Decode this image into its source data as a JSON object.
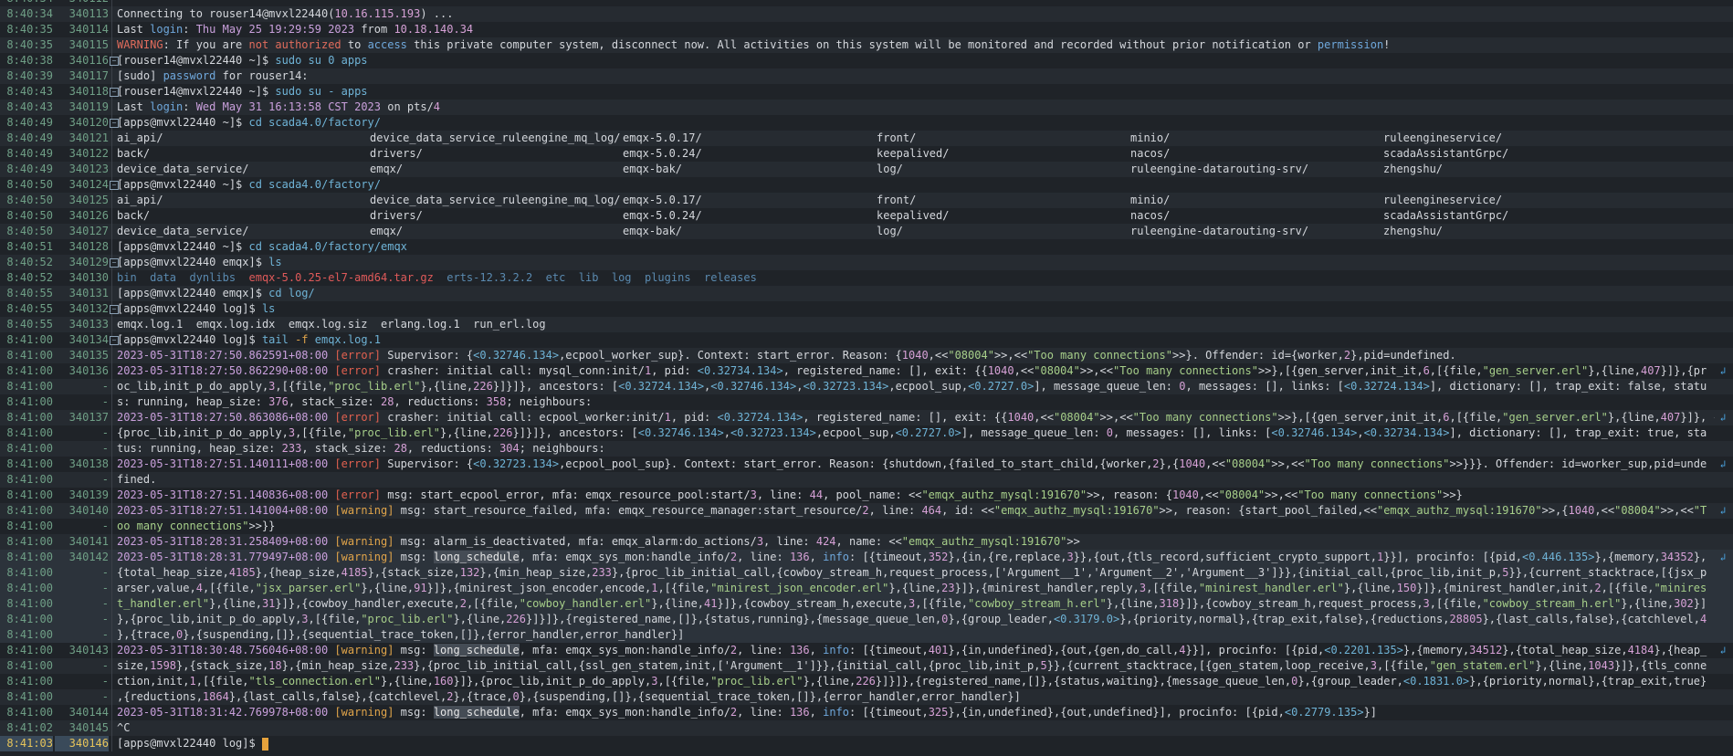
{
  "terminal": {
    "lines": [
      {
        "ts": "8:40:34",
        "ln": "340112",
        "html": ""
      },
      {
        "ts": "8:40:34",
        "ln": "340113",
        "html": "Connecting to rouser14@mvxl22440(<span class='c-ip'>10.16.115.193</span>) ..."
      },
      {
        "ts": "8:40:35",
        "ln": "340114",
        "html": "Last <span class='c-blue'>login</span>: <span class='c-date'>Thu May 25 19:29:59 2023</span> from <span class='c-ip'>10.18.140.34</span>"
      },
      {
        "ts": "8:40:35",
        "ln": "340115",
        "html": "<span class='c-warnword'>WARNING</span>: If you are <span class='c-warnword'>not authorized</span> to <span class='c-blue'>access</span> this private computer system, disconnect now. All activities on this system will be monitored and recorded without prior notification or <span class='c-blue'>permission</span>!"
      },
      {
        "ts": "8:40:38",
        "ln": "340116",
        "fold": true,
        "html": "[rouser14@mvxl22440 ~]$ <span class='c-cmd'>sudo su 0 apps</span>"
      },
      {
        "ts": "8:40:39",
        "ln": "340117",
        "html": "[sudo] <span class='c-blue'>password</span> for rouser14:"
      },
      {
        "ts": "8:40:43",
        "ln": "340118",
        "fold": true,
        "html": "[rouser14@mvxl22440 ~]$ <span class='c-cmd'>sudo su - apps</span>"
      },
      {
        "ts": "8:40:43",
        "ln": "340119",
        "html": "Last <span class='c-blue'>login</span>: <span class='c-date'>Wed May 31 16:13:58 CST 2023</span> on pts/<span class='c-num'>4</span>"
      },
      {
        "ts": "8:40:49",
        "ln": "340120",
        "fold": true,
        "html": "[apps@mvxl22440 ~]$ <span class='c-cmd'>cd scada4.0/factory/</span>"
      },
      {
        "ts": "8:40:49",
        "ln": "340121",
        "cols": [
          "ai_api/",
          "device_data_service_ruleengine_mq_log/",
          "emqx-5.0.17/",
          "front/",
          "minio/",
          "ruleengineservice/"
        ]
      },
      {
        "ts": "8:40:49",
        "ln": "340122",
        "cols": [
          "back/",
          "drivers/",
          "emqx-5.0.24/",
          "keepalived/",
          "nacos/",
          "scadaAssistantGrpc/"
        ]
      },
      {
        "ts": "8:40:49",
        "ln": "340123",
        "cols": [
          "device_data_service/",
          "emqx/",
          "emqx-bak/",
          "log/",
          "ruleengine-datarouting-srv/",
          "zhengshu/"
        ]
      },
      {
        "ts": "8:40:50",
        "ln": "340124",
        "fold": true,
        "html": "[apps@mvxl22440 ~]$ <span class='c-cmd'>cd scada4.0/factory/</span>"
      },
      {
        "ts": "8:40:50",
        "ln": "340125",
        "cols": [
          "ai_api/",
          "device_data_service_ruleengine_mq_log/",
          "emqx-5.0.17/",
          "front/",
          "minio/",
          "ruleengineservice/"
        ]
      },
      {
        "ts": "8:40:50",
        "ln": "340126",
        "cols": [
          "back/",
          "drivers/",
          "emqx-5.0.24/",
          "keepalived/",
          "nacos/",
          "scadaAssistantGrpc/"
        ]
      },
      {
        "ts": "8:40:50",
        "ln": "340127",
        "cols": [
          "device_data_service/",
          "emqx/",
          "emqx-bak/",
          "log/",
          "ruleengine-datarouting-srv/",
          "zhengshu/"
        ]
      },
      {
        "ts": "8:40:51",
        "ln": "340128",
        "html": "[apps@mvxl22440 ~]$ <span class='c-cmd'>cd scada4.0/factory/emqx</span>"
      },
      {
        "ts": "8:40:52",
        "ln": "340129",
        "fold": true,
        "html": "[apps@mvxl22440 emqx]$ <span class='c-cmd'>ls</span>"
      },
      {
        "ts": "8:40:52",
        "ln": "340130",
        "html": "<span class='c-ls'>bin  data  dynlibs  </span><span class='c-tar'>emqx-5.0.25-el7-amd64.tar.gz</span><span class='c-ls'>  erts-12.3.2.2  etc  lib  log  plugins  releases</span>"
      },
      {
        "ts": "8:40:55",
        "ln": "340131",
        "html": "[apps@mvxl22440 emqx]$ <span class='c-cmd'>cd log/</span>"
      },
      {
        "ts": "8:40:55",
        "ln": "340132",
        "fold": true,
        "html": "[apps@mvxl22440 log]$ <span class='c-cmd'>ls</span>"
      },
      {
        "ts": "8:40:55",
        "ln": "340133",
        "html": "emqx.log.1  emqx.log.idx  emqx.log.siz  erlang.log.1  run_erl.log"
      },
      {
        "ts": "8:41:00",
        "ln": "340134",
        "fold": true,
        "html": "[apps@mvxl22440 log]$ <span class='c-cmd'>tail <span class='c-warn'>-f</span> emqx.log.1</span>"
      },
      {
        "ts": "8:41:00",
        "ln": "340135",
        "html": "<span class='c-date'>2023-05-31T18:27:50.862591+08:00</span> <span class='c-lvl'>[error]</span> Supervisor: {<span class='c-pid'>&lt;0.32746.134&gt;</span>,ecpool_worker_sup}. Context: start_error. Reason: {<span class='c-num'>1040</span>,&lt;&lt;<span class='c-str'>\"08004\"</span>&gt;&gt;,&lt;&lt;<span class='c-str'>\"Too many connections\"</span>&gt;&gt;}. Offender: id={worker,<span class='c-num'>2</span>},pid=undefined."
      },
      {
        "ts": "8:41:00",
        "ln": "340136",
        "wrap": true,
        "html": "<span class='c-date'>2023-05-31T18:27:50.862290+08:00</span> <span class='c-lvl'>[error]</span> crasher: initial call: mysql_conn:init/<span class='c-num'>1</span>, pid: <span class='c-pid'>&lt;0.32734.134&gt;</span>, registered_name: [], exit: {{<span class='c-num'>1040</span>,&lt;&lt;<span class='c-str'>\"08004\"</span>&gt;&gt;,&lt;&lt;<span class='c-str'>\"Too many connections\"</span>&gt;&gt;},[{gen_server,init_it,<span class='c-num'>6</span>,[{file,<span class='c-str'>\"gen_server.erl\"</span>},{line,<span class='c-num'>407</span>}]},{pr"
      },
      {
        "ts": "8:41:00",
        "ln": "-",
        "html": "oc_lib,init_p_do_apply,<span class='c-num'>3</span>,[{file,<span class='c-str'>\"proc_lib.erl\"</span>},{line,<span class='c-num'>226</span>}]}]}, ancestors: [<span class='c-pid'>&lt;0.32724.134&gt;</span>,<span class='c-pid'>&lt;0.32746.134&gt;</span>,<span class='c-pid'>&lt;0.32723.134&gt;</span>,ecpool_sup,<span class='c-pid'>&lt;0.2727.0&gt;</span>], message_queue_len: <span class='c-num'>0</span>, messages: [], links: [<span class='c-pid'>&lt;0.32724.134&gt;</span>], dictionary: [], trap_exit: false, statu"
      },
      {
        "ts": "8:41:00",
        "ln": "-",
        "html": "s: running, heap_size: <span class='c-num'>376</span>, stack_size: <span class='c-num'>28</span>, reductions: <span class='c-num'>358</span>; neighbours:"
      },
      {
        "ts": "8:41:00",
        "ln": "340137",
        "wrap": true,
        "html": "<span class='c-date'>2023-05-31T18:27:50.863086+08:00</span> <span class='c-lvl'>[error]</span> crasher: initial call: ecpool_worker:init/<span class='c-num'>1</span>, pid: <span class='c-pid'>&lt;0.32724.134&gt;</span>, registered_name: [], exit: {{<span class='c-num'>1040</span>,&lt;&lt;<span class='c-str'>\"08004\"</span>&gt;&gt;,&lt;&lt;<span class='c-str'>\"Too many connections\"</span>&gt;&gt;},[{gen_server,init_it,<span class='c-num'>6</span>,[{file,<span class='c-str'>\"gen_server.erl\"</span>},{line,<span class='c-num'>407</span>}]}, {"
      },
      {
        "ts": "8:41:00",
        "ln": "-",
        "html": "{proc_lib,init_p_do_apply,<span class='c-num'>3</span>,[{file,<span class='c-str'>\"proc_lib.erl\"</span>},{line,<span class='c-num'>226</span>}]}]}, ancestors: [<span class='c-pid'>&lt;0.32746.134&gt;</span>,<span class='c-pid'>&lt;0.32723.134&gt;</span>,ecpool_sup,<span class='c-pid'>&lt;0.2727.0&gt;</span>], message_queue_len: <span class='c-num'>0</span>, messages: [], links: [<span class='c-pid'>&lt;0.32746.134&gt;</span>,<span class='c-pid'>&lt;0.32734.134&gt;</span>], dictionary: [], trap_exit: true, sta"
      },
      {
        "ts": "8:41:00",
        "ln": "-",
        "html": "tus: running, heap_size: <span class='c-num'>233</span>, stack_size: <span class='c-num'>28</span>, reductions: <span class='c-num'>304</span>; neighbours:"
      },
      {
        "ts": "8:41:00",
        "ln": "340138",
        "wrap": true,
        "html": "<span class='c-date'>2023-05-31T18:27:51.140111+08:00</span> <span class='c-lvl'>[error]</span> Supervisor: {<span class='c-pid'>&lt;0.32723.134&gt;</span>,ecpool_pool_sup}. Context: start_error. Reason: {shutdown,{failed_to_start_child,{worker,<span class='c-num'>2</span>},{<span class='c-num'>1040</span>,&lt;&lt;<span class='c-str'>\"08004\"</span>&gt;&gt;,&lt;&lt;<span class='c-str'>\"Too many connections\"</span>&gt;&gt;}}}. Offender: id=worker_sup,pid=unde"
      },
      {
        "ts": "8:41:00",
        "ln": "-",
        "html": "fined."
      },
      {
        "ts": "8:41:00",
        "ln": "340139",
        "html": "<span class='c-date'>2023-05-31T18:27:51.140836+08:00</span> <span class='c-lvl'>[error]</span> msg: start_ecpool_error, mfa: emqx_resource_pool:start/<span class='c-num'>3</span>, line: <span class='c-num'>44</span>, pool_name: &lt;&lt;<span class='c-str'>\"emqx_authz_mysql:191670\"</span>&gt;&gt;, reason: {<span class='c-num'>1040</span>,&lt;&lt;<span class='c-str'>\"08004\"</span>&gt;&gt;,&lt;&lt;<span class='c-str'>\"Too many connections\"</span>&gt;&gt;}"
      },
      {
        "ts": "8:41:00",
        "ln": "340140",
        "wrap": true,
        "html": "<span class='c-date'>2023-05-31T18:27:51.141004+08:00</span> <span class='c-warn'>[warning]</span> msg: start_resource_failed, mfa: emqx_resource_manager:start_resource/<span class='c-num'>2</span>, line: <span class='c-num'>464</span>, id: &lt;&lt;<span class='c-str'>\"emqx_authz_mysql:191670\"</span>&gt;&gt;, reason: {start_pool_failed,&lt;&lt;<span class='c-str'>\"emqx_authz_mysql:191670\"</span>&gt;&gt;,{<span class='c-num'>1040</span>,&lt;&lt;<span class='c-str'>\"08004\"</span>&gt;&gt;,&lt;&lt;<span class='c-str'>\"T</span>"
      },
      {
        "ts": "8:41:00",
        "ln": "-",
        "html": "<span class='c-str'>oo many connections\"</span>&gt;&gt;}}"
      },
      {
        "ts": "8:41:00",
        "ln": "340141",
        "html": "<span class='c-date'>2023-05-31T18:28:31.258409+08:00</span> <span class='c-warn'>[warning]</span> msg: alarm_is_deactivated, mfa: emqx_alarm:do_actions/<span class='c-num'>3</span>, line: <span class='c-num'>424</span>, name: &lt;&lt;<span class='c-str'>\"emqx_authz_mysql:191670\"</span>&gt;&gt;"
      },
      {
        "ts": "8:41:00",
        "ln": "340142",
        "wrap": true,
        "hl": true,
        "html": "<span class='c-date'>2023-05-31T18:28:31.779497+08:00</span> <span class='c-warn'>[warning]</span> msg: <span class='c-long'>long_schedule</span>, mfa: emqx_sys_mon:handle_info/<span class='c-num'>2</span>, line: <span class='c-num'>136</span>, <span class='c-blue'>info</span>: [{timeout,<span class='c-num'>352</span>},{in,{re,replace,<span class='c-num'>3</span>}},{out,{tls_record,sufficient_crypto_support,<span class='c-num'>1</span>}}], procinfo: [{pid,<span class='c-pid'>&lt;0.446.135&gt;</span>},{memory,<span class='c-num'>34352</span>},"
      },
      {
        "ts": "8:41:00",
        "ln": "-",
        "hl": true,
        "html": "{total_heap_size,<span class='c-num'>4185</span>},{heap_size,<span class='c-num'>4185</span>},{stack_size,<span class='c-num'>132</span>},{min_heap_size,<span class='c-num'>233</span>},{proc_lib_initial_call,{cowboy_stream_h,request_process,['Argument__1','Argument__2','Argument__3']}},{initial_call,{proc_lib,init_p,<span class='c-num'>5</span>}},{current_stacktrace,[{jsx_p"
      },
      {
        "ts": "8:41:00",
        "ln": "-",
        "hl": true,
        "html": "arser,value,<span class='c-num'>4</span>,[{file,<span class='c-str'>\"jsx_parser.erl\"</span>},{line,<span class='c-num'>91</span>}]},{minirest_json_encoder,encode,<span class='c-num'>1</span>,[{file,<span class='c-str'>\"minirest_json_encoder.erl\"</span>},{line,<span class='c-num'>23</span>}]},{minirest_handler,reply,<span class='c-num'>3</span>,[{file,<span class='c-str'>\"minirest_handler.erl\"</span>},{line,<span class='c-num'>150</span>}]},{minirest_handler,init,<span class='c-num'>2</span>,[{file,<span class='c-str'>\"minires</span>"
      },
      {
        "ts": "8:41:00",
        "ln": "-",
        "hl": true,
        "html": "<span class='c-str'>t_handler.erl\"</span>},{line,<span class='c-num'>31</span>}]},{cowboy_handler,execute,<span class='c-num'>2</span>,[{file,<span class='c-str'>\"cowboy_handler.erl\"</span>},{line,<span class='c-num'>41</span>}]},{cowboy_stream_h,execute,<span class='c-num'>3</span>,[{file,<span class='c-str'>\"cowboy_stream_h.erl\"</span>},{line,<span class='c-num'>318</span>}]},{cowboy_stream_h,request_process,<span class='c-num'>3</span>,[{file,<span class='c-str'>\"cowboy_stream_h.erl\"</span>},{line,<span class='c-num'>302</span>}]"
      },
      {
        "ts": "8:41:00",
        "ln": "-",
        "hl": true,
        "html": "},{proc_lib,init_p_do_apply,<span class='c-num'>3</span>,[{file,<span class='c-str'>\"proc_lib.erl\"</span>},{line,<span class='c-num'>226</span>}]}]},{registered_name,[]},{status,running},{message_queue_len,<span class='c-num'>0</span>},{group_leader,<span class='c-pid'>&lt;0.3179.0&gt;</span>},{priority,normal},{trap_exit,false},{reductions,<span class='c-num'>28805</span>},{last_calls,false},{catchlevel,<span class='c-num'>4</span>"
      },
      {
        "ts": "8:41:00",
        "ln": "-",
        "hl": true,
        "html": "},{trace,<span class='c-num'>0</span>},{suspending,[]},{sequential_trace_token,[]},{error_handler,error_handler}]"
      },
      {
        "ts": "8:41:00",
        "ln": "340143",
        "wrap": true,
        "html": "<span class='c-date'>2023-05-31T18:30:48.756046+08:00</span> <span class='c-warn'>[warning]</span> msg: <span class='c-long'>long_schedule</span>, mfa: emqx_sys_mon:handle_info/<span class='c-num'>2</span>, line: <span class='c-num'>136</span>, <span class='c-blue'>info</span>: [{timeout,<span class='c-num'>401</span>},{in,undefined},{out,{gen,do_call,<span class='c-num'>4</span>}}], procinfo: [{pid,<span class='c-pid'>&lt;0.2201.135&gt;</span>},{memory,<span class='c-num'>34512</span>},{total_heap_size,<span class='c-num'>4184</span>},{heap_"
      },
      {
        "ts": "8:41:00",
        "ln": "-",
        "html": "size,<span class='c-num'>1598</span>},{stack_size,<span class='c-num'>18</span>},{min_heap_size,<span class='c-num'>233</span>},{proc_lib_initial_call,{ssl_gen_statem,init,['Argument__1']}},{initial_call,{proc_lib,init_p,<span class='c-num'>5</span>}},{current_stacktrace,[{gen_statem,loop_receive,<span class='c-num'>3</span>,[{file,<span class='c-str'>\"gen_statem.erl\"</span>},{line,<span class='c-num'>1043</span>}]},{tls_conne"
      },
      {
        "ts": "8:41:00",
        "ln": "-",
        "html": "ction,init,<span class='c-num'>1</span>,[{file,<span class='c-str'>\"tls_connection.erl\"</span>},{line,<span class='c-num'>160</span>}]},{proc_lib,init_p_do_apply,<span class='c-num'>3</span>,[{file,<span class='c-str'>\"proc_lib.erl\"</span>},{line,<span class='c-num'>226</span>}]}]},{registered_name,[]},{status,waiting},{message_queue_len,<span class='c-num'>0</span>},{group_leader,<span class='c-pid'>&lt;0.1831.0&gt;</span>},{priority,normal},{trap_exit,true}"
      },
      {
        "ts": "8:41:00",
        "ln": "-",
        "html": ",{reductions,<span class='c-num'>1864</span>},{last_calls,false},{catchlevel,<span class='c-num'>2</span>},{trace,<span class='c-num'>0</span>},{suspending,[]},{sequential_trace_token,[]},{error_handler,error_handler}]"
      },
      {
        "ts": "8:41:00",
        "ln": "340144",
        "html": "<span class='c-date'>2023-05-31T18:31:42.769978+08:00</span> <span class='c-warn'>[warning]</span> msg: <span class='c-long'>long_schedule</span>, mfa: emqx_sys_mon:handle_info/<span class='c-num'>2</span>, line: <span class='c-num'>136</span>, <span class='c-blue'>info</span>: [{timeout,<span class='c-num'>325</span>},{in,undefined},{out,undefined}], procinfo: [{pid,<span class='c-pid'>&lt;0.2779.135&gt;</span>}]"
      },
      {
        "ts": "8:41:02",
        "ln": "340145",
        "html": "^C"
      },
      {
        "ts": "8:41:03",
        "ln": "340146",
        "last": true,
        "html": "[apps@mvxl22440 log]$ "
      }
    ],
    "colors": {
      "background": "#1f2328",
      "gutter_text": "#6f9f86",
      "cursor": "#e6a23c"
    }
  }
}
